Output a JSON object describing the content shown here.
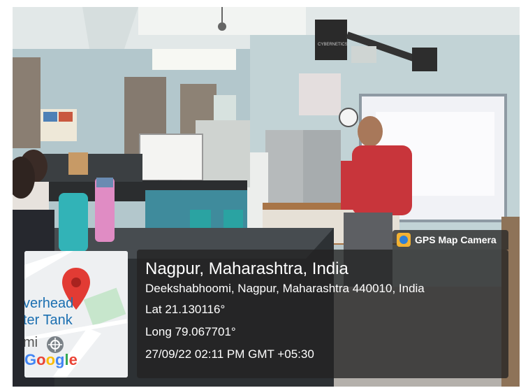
{
  "badge": {
    "label": "GPS Map Camera",
    "icon": "camera-icon"
  },
  "location": {
    "title": "Nagpur, Maharashtra, India",
    "address": "Deekshabhoomi, Nagpur, Maharashtra 440010, India",
    "lat": "Lat 21.130116°",
    "long": "Long 79.067701°",
    "datetime": "27/09/22 02:11 PM GMT +05:30"
  },
  "map": {
    "label_line1": "verhead",
    "label_line2": "ter Tank",
    "label_line3": "mi",
    "logo": "Google",
    "pin_icon": "map-pin-icon",
    "landmark_icon": "dharma-wheel-icon"
  },
  "photo": {
    "projector_label": "CYBERNETICS"
  },
  "colors": {
    "pin": "#e23b34",
    "overlay": "#232323",
    "shirt": "#c8353b"
  }
}
